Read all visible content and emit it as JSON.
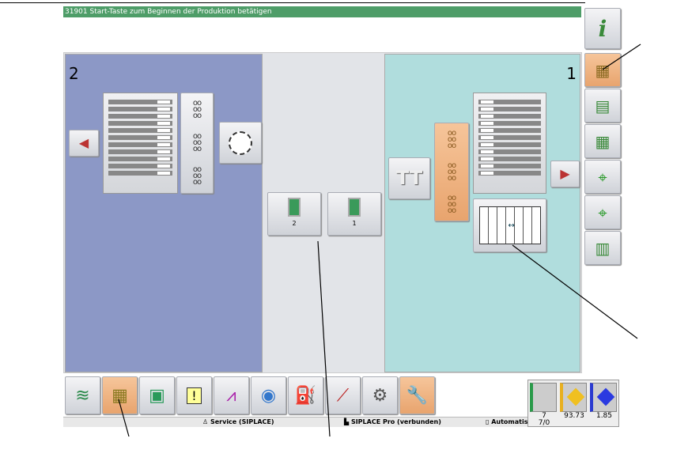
{
  "title_bar": {
    "message": "31901 Start-Taste zum Beginnen der Produktion betätigen"
  },
  "stations": {
    "left_number": "2",
    "right_number": "1"
  },
  "center": {
    "button_2_label": "2",
    "button_1_label": "1"
  },
  "right_toolbar": [
    {
      "icon": "info-icon",
      "glyph": "i"
    },
    {
      "icon": "feeder-grid-icon",
      "selected": true
    },
    {
      "icon": "component-list-icon"
    },
    {
      "icon": "component-matrix-icon"
    },
    {
      "icon": "conveyor-icon"
    },
    {
      "icon": "board-position-icon"
    },
    {
      "icon": "bar-chart-icon"
    }
  ],
  "bottom_toolbar": [
    {
      "icon": "stacks-icon"
    },
    {
      "icon": "feeder-grid-icon",
      "selected": true
    },
    {
      "icon": "board-icon"
    },
    {
      "icon": "alert-icon"
    },
    {
      "icon": "line-chart-icon"
    },
    {
      "icon": "camera-icon"
    },
    {
      "icon": "oil-can-icon"
    },
    {
      "icon": "tool-icon"
    },
    {
      "icon": "hand-gear-icon"
    },
    {
      "icon": "wrench-icon",
      "selected": true
    }
  ],
  "status_bar": {
    "user": "Service (SIPLACE)",
    "connection": "SIPLACE Pro (verbunden)",
    "mode": "Automatis"
  },
  "gauges": {
    "count": "7",
    "ratio": "7/0",
    "yellow_value": "93.73",
    "blue_value": "1.85"
  },
  "colors": {
    "title": "#4e9d68",
    "left_panel": "#8c98c6",
    "right_panel": "#b0dddd",
    "selected": "#f0b07e"
  }
}
